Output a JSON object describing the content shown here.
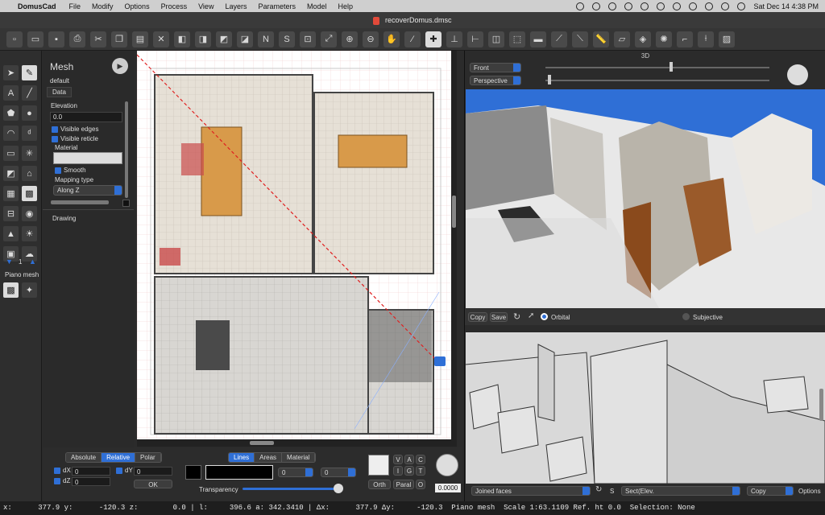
{
  "menubar": {
    "apple": "",
    "app_name": "DomusCad",
    "items": [
      "File",
      "Modify",
      "Options",
      "Process",
      "View",
      "Layers",
      "Parameters",
      "Model",
      "Help"
    ],
    "clock": "Sat Dec 14  4:38 PM"
  },
  "window": {
    "title": "recoverDomus.dmsc",
    "tab_number": "1"
  },
  "toolbar": {
    "text_tools": [
      "N",
      "S"
    ]
  },
  "props": {
    "header": "Mesh",
    "object_name": "default",
    "tab_data": "Data",
    "elevation_label": "Elevation",
    "elevation_value": "0.0",
    "visible_edges": "Visible edges",
    "visible_reticle": "Visible reticle",
    "material_label": "Material",
    "smooth": "Smooth",
    "mapping_type_label": "Mapping type",
    "mapping_type_value": "Along Z",
    "drawing_label": "Drawing"
  },
  "lefttools": {
    "stepper_value": "1",
    "piano_mesh": "Piano mesh"
  },
  "bottom": {
    "coord_modes": [
      "Absolute",
      "Relative",
      "Polar"
    ],
    "coord_active": "Relative",
    "dx_label": "dX",
    "dx_value": "0",
    "dy_label": "dY",
    "dy_value": "0",
    "dz_label": "dZ",
    "dz_value": "0",
    "ok": "OK",
    "style_tabs": [
      "Lines",
      "Areas",
      "Material"
    ],
    "style_active": "Lines",
    "line_width_1": "0",
    "line_width_2": "0",
    "transparency": "Transparency",
    "vac": [
      "V",
      "A",
      "C"
    ],
    "igt": [
      "I",
      "G",
      "T"
    ],
    "orth": "Orth",
    "paral": "Paral",
    "o": "O",
    "angle": "0.0000"
  },
  "view3d": {
    "title": "3D",
    "view_select": "Front",
    "projection_select": "Perspective",
    "copy": "Copy",
    "save": "Save",
    "orbital": "Orbital",
    "subjective": "Subjective",
    "render_mode": "Joined faces",
    "s_label": "S",
    "section_select": "Sect(Elev.",
    "copy_select": "Copy",
    "options": "Options"
  },
  "statusbar": {
    "text": "x:      377.9 y:      -120.3 z:        0.0 | l:     396.6 a: 342.3410 | Δx:      377.9 Δy:     -120.3  Piano mesh  Scale 1:63.1109 Ref. ht 0.0  Selection: None"
  }
}
